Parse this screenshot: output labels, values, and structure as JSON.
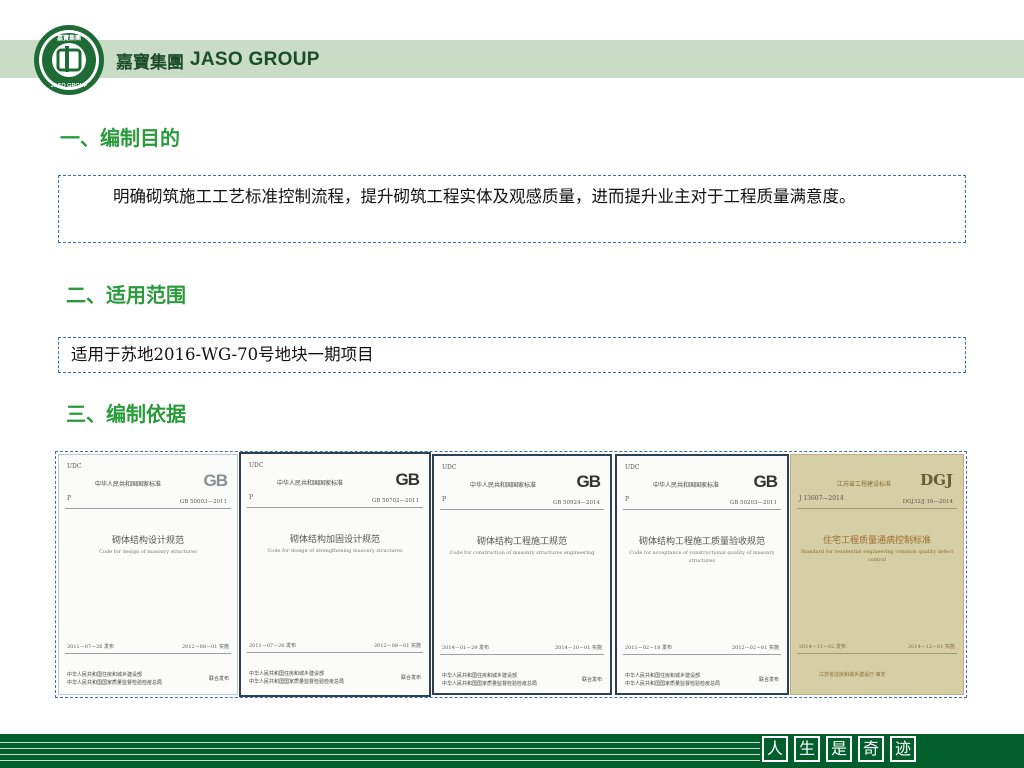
{
  "brand": {
    "name_cn": "嘉寶集團",
    "name_en": "JASO GROUP",
    "logo_text_top": "嘉寶集團",
    "logo_text_bottom": "JASO GROUP"
  },
  "sections": [
    {
      "title": "一、编制目的",
      "body": "明确砌筑施工工艺标准控制流程，提升砌筑工程实体及观感质量，进而提升业主对于工程质量满意度。"
    },
    {
      "title": "二、适用范围",
      "body": "适用于苏地2016-WG-70号地块一期项目"
    },
    {
      "title": "三、编制依据"
    }
  ],
  "covers": [
    {
      "udc": "UDC",
      "issuer": "中华人民共和国国家标准",
      "mark": "GB",
      "p": "P",
      "code": "GB 50003—2011",
      "title": "砌体结构设计规范",
      "subtitle": "Code for design of masonry structures",
      "date_left": "2011－07－26  发布",
      "date_right": "2012－08－01  实施",
      "publisher": "中华人民共和国住房和城乡建设部\n中华人民共和国国家质量监督检验检疫总局",
      "joint": "联合发布"
    },
    {
      "udc": "UDC",
      "issuer": "中华人民共和国国家标准",
      "mark": "GB",
      "p": "P",
      "code": "GB 50702—2011",
      "title": "砌体结构加固设计规范",
      "subtitle": "Code for design of strengthening masonry structures",
      "date_left": "2011－07－26  发布",
      "date_right": "2012－08－01  实施",
      "publisher": "中华人民共和国住房和城乡建设部\n中华人民共和国国家质量监督检验检疫总局",
      "joint": "联合发布"
    },
    {
      "udc": "UDC",
      "issuer": "中华人民共和国国家标准",
      "mark": "GB",
      "p": "P",
      "code": "GB 50924—2014",
      "title": "砌体结构工程施工规范",
      "subtitle": "Code for construction of masonry structures engineering",
      "date_left": "2014－01－29  发布",
      "date_right": "2014－10－01  实施",
      "publisher": "中华人民共和国住房和城乡建设部\n中华人民共和国国家质量监督检验检疫总局",
      "joint": "联合发布"
    },
    {
      "udc": "UDC",
      "issuer": "中华人民共和国国家标准",
      "mark": "GB",
      "p": "P",
      "code": "GB 50203—2011",
      "title": "砌体结构工程施工质量验收规范",
      "subtitle": "Code for acceptance of constructional quality of masonry structures",
      "date_left": "2011－02－18  发布",
      "date_right": "2012－02－01  实施",
      "publisher": "中华人民共和国住房和城乡建设部\n中华人民共和国国家质量监督检验检疫总局",
      "joint": "联合发布"
    },
    {
      "udc": "",
      "issuer": "江苏省工程建设标准",
      "mark": "DGJ",
      "p": "J 13607—2014",
      "code": "DGJ32/J 16—2014",
      "title": "住宅工程质量通病控制标准",
      "subtitle": "Standard for residential engineering common quality defect control",
      "date_left": "2014－11－02  发布",
      "date_right": "2014－12－01  实施",
      "publisher": "江苏省住房和城乡建设厅  审定",
      "joint": ""
    }
  ],
  "footer": {
    "slogan": [
      "人",
      "生",
      "是",
      "奇",
      "迹"
    ]
  },
  "colors": {
    "accent_green": "#2a9b3b",
    "dark_green": "#005f2a",
    "header_band": "#c9dcc4",
    "dashed_border": "#3e6fa8"
  }
}
